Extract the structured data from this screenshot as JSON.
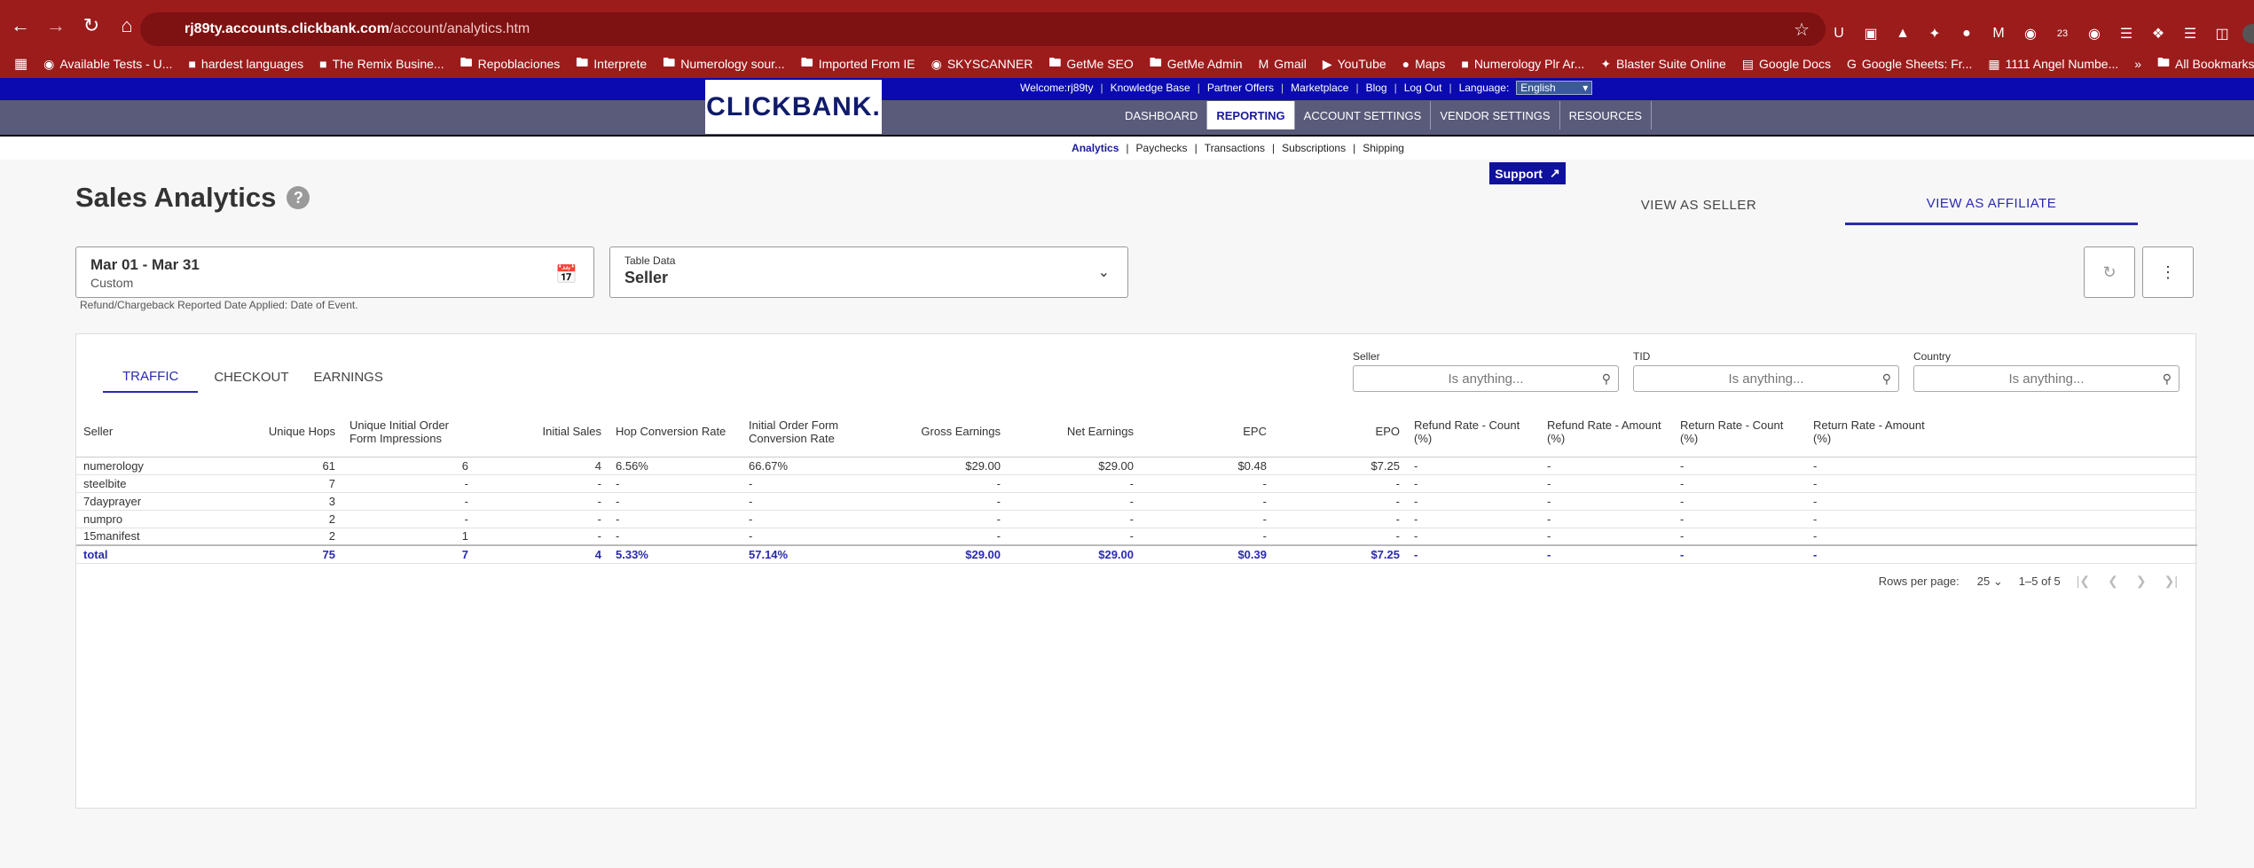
{
  "browser": {
    "url_host": "rj89ty.accounts.clickbank.com",
    "url_path": "/account/analytics.htm",
    "ext_badge": "23",
    "bookmarks": [
      "Available Tests - U...",
      "hardest languages",
      "The Remix Busine...",
      "Repoblaciones",
      "Interprete",
      "Numerology sour...",
      "Imported From IE",
      "SKYSCANNER",
      "GetMe SEO",
      "GetMe Admin",
      "Gmail",
      "YouTube",
      "Maps",
      "Numerology Plr Ar...",
      "Blaster Suite Online",
      "Google Docs",
      "Google Sheets: Fr...",
      "1111 Angel Numbe..."
    ],
    "all_bookmarks": "All Bookmarks"
  },
  "header": {
    "logo": "CLICKBANK.",
    "welcome": "Welcome:rj89ty",
    "links": [
      "Knowledge Base",
      "Partner Offers",
      "Marketplace",
      "Blog",
      "Log Out"
    ],
    "language_label": "Language:",
    "language_value": "English",
    "main_tabs": [
      "DASHBOARD",
      "REPORTING",
      "ACCOUNT SETTINGS",
      "VENDOR SETTINGS",
      "RESOURCES"
    ],
    "sub_nav": [
      "Analytics",
      "Paychecks",
      "Transactions",
      "Subscriptions",
      "Shipping"
    ],
    "support": "Support"
  },
  "page": {
    "title": "Sales Analytics",
    "help": "?",
    "view_tabs": [
      "VIEW AS SELLER",
      "VIEW AS AFFILIATE"
    ],
    "date_range": "Mar 01 - Mar 31",
    "date_type": "Custom",
    "table_data_label": "Table Data",
    "table_data_value": "Seller",
    "refund_note": "Refund/Chargeback Reported Date Applied: Date of Event."
  },
  "report": {
    "tabs": [
      "TRAFFIC",
      "CHECKOUT",
      "EARNINGS"
    ],
    "filters": [
      {
        "label": "Seller",
        "placeholder": "Is anything..."
      },
      {
        "label": "TID",
        "placeholder": "Is anything..."
      },
      {
        "label": "Country",
        "placeholder": "Is anything..."
      }
    ],
    "columns": [
      "Seller",
      "Unique Hops",
      "Unique Initial Order Form Impressions",
      "Initial Sales",
      "Hop Conversion Rate",
      "Initial Order Form Conversion Rate",
      "Gross Earnings",
      "Net Earnings",
      "EPC",
      "EPO",
      "Refund Rate - Count (%)",
      "Refund Rate - Amount (%)",
      "Return Rate - Count (%)",
      "Return Rate - Amount (%)"
    ],
    "rows": [
      [
        "numerology",
        "61",
        "6",
        "4",
        "6.56%",
        "66.67%",
        "$29.00",
        "$29.00",
        "$0.48",
        "$7.25",
        "-",
        "-",
        "-",
        "-"
      ],
      [
        "steelbite",
        "7",
        "-",
        "-",
        "-",
        "-",
        "-",
        "-",
        "-",
        "-",
        "-",
        "-",
        "-",
        "-"
      ],
      [
        "7dayprayer",
        "3",
        "-",
        "-",
        "-",
        "-",
        "-",
        "-",
        "-",
        "-",
        "-",
        "-",
        "-",
        "-"
      ],
      [
        "numpro",
        "2",
        "-",
        "-",
        "-",
        "-",
        "-",
        "-",
        "-",
        "-",
        "-",
        "-",
        "-",
        "-"
      ],
      [
        "15manifest",
        "2",
        "1",
        "-",
        "-",
        "-",
        "-",
        "-",
        "-",
        "-",
        "-",
        "-",
        "-",
        "-"
      ]
    ],
    "total": [
      "total",
      "75",
      "7",
      "4",
      "5.33%",
      "57.14%",
      "$29.00",
      "$29.00",
      "$0.39",
      "$7.25",
      "-",
      "-",
      "-",
      "-"
    ],
    "rows_per_page_label": "Rows per page:",
    "rows_per_page": "25",
    "range": "1–5 of 5"
  }
}
